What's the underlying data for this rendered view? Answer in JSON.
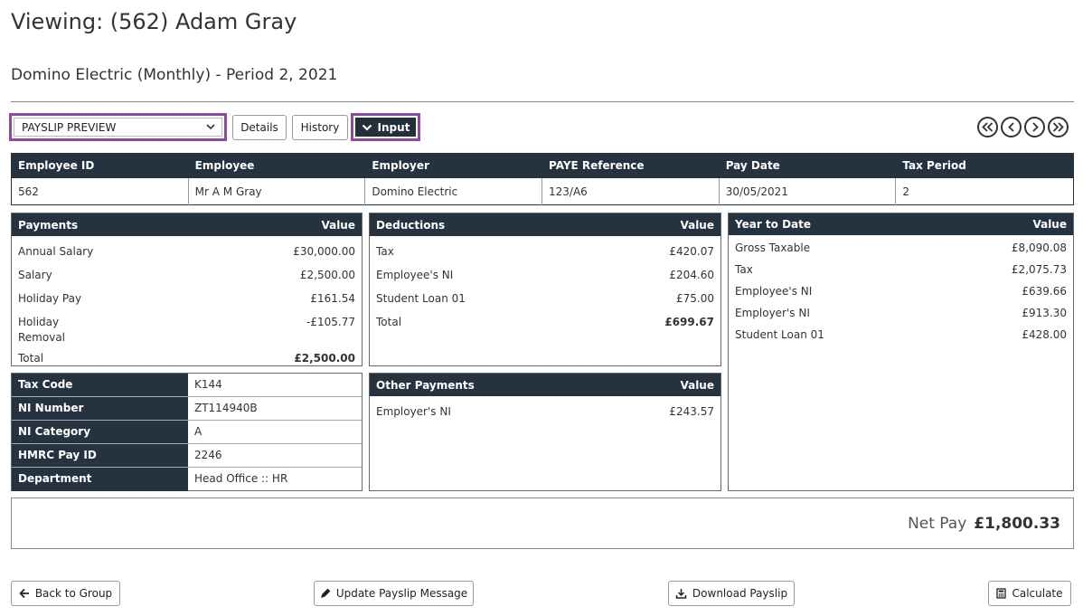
{
  "page": {
    "title": "Viewing: (562) Adam Gray",
    "subtitle": "Domino Electric (Monthly) - Period 2, 2021"
  },
  "toolbar": {
    "select_value": "PAYSLIP PREVIEW",
    "details_label": "Details",
    "history_label": "History",
    "input_label": "Input"
  },
  "header_table": {
    "columns": [
      "Employee ID",
      "Employee",
      "Employer",
      "PAYE Reference",
      "Pay Date",
      "Tax Period"
    ],
    "values": [
      "562",
      "Mr A M Gray",
      "Domino Electric",
      "123/A6",
      "30/05/2021",
      "2"
    ]
  },
  "payments": {
    "title": "Payments",
    "value_header": "Value",
    "rows": [
      {
        "label": "Annual Salary",
        "value": "£30,000.00"
      },
      {
        "label": "Salary",
        "value": "£2,500.00"
      },
      {
        "label": "Holiday Pay",
        "value": "£161.54"
      },
      {
        "label": "Holiday Removal",
        "value": "-£105.77"
      },
      {
        "label": "Total",
        "value": "£2,500.00"
      }
    ]
  },
  "deductions": {
    "title": "Deductions",
    "value_header": "Value",
    "rows": [
      {
        "label": "Tax",
        "value": "£420.07"
      },
      {
        "label": "Employee's NI",
        "value": "£204.60"
      },
      {
        "label": "Student Loan 01",
        "value": "£75.00"
      },
      {
        "label": "Total",
        "value": "£699.67"
      }
    ]
  },
  "ytd": {
    "title": "Year to Date",
    "value_header": "Value",
    "rows": [
      {
        "label": "Gross Taxable",
        "value": "£8,090.08"
      },
      {
        "label": "Tax",
        "value": "£2,075.73"
      },
      {
        "label": "Employee's NI",
        "value": "£639.66"
      },
      {
        "label": "Employer's NI",
        "value": "£913.30"
      },
      {
        "label": "Student Loan 01",
        "value": "£428.00"
      }
    ]
  },
  "info": {
    "rows": [
      {
        "label": "Tax Code",
        "value": "K144"
      },
      {
        "label": "NI Number",
        "value": "ZT114940B"
      },
      {
        "label": "NI Category",
        "value": "A"
      },
      {
        "label": "HMRC Pay ID",
        "value": "2246"
      },
      {
        "label": "Department",
        "value": "Head Office :: HR"
      }
    ]
  },
  "other_payments": {
    "title": "Other Payments",
    "value_header": "Value",
    "rows": [
      {
        "label": "Employer's NI",
        "value": "£243.57"
      }
    ]
  },
  "net_pay": {
    "label": "Net Pay",
    "value": "£1,800.33"
  },
  "footer": {
    "back_label": "Back to Group",
    "update_label": "Update Payslip Message",
    "download_label": "Download Payslip",
    "calculate_label": "Calculate"
  },
  "colors": {
    "accent": "#8c4a9c",
    "header_dark": "#253341"
  }
}
